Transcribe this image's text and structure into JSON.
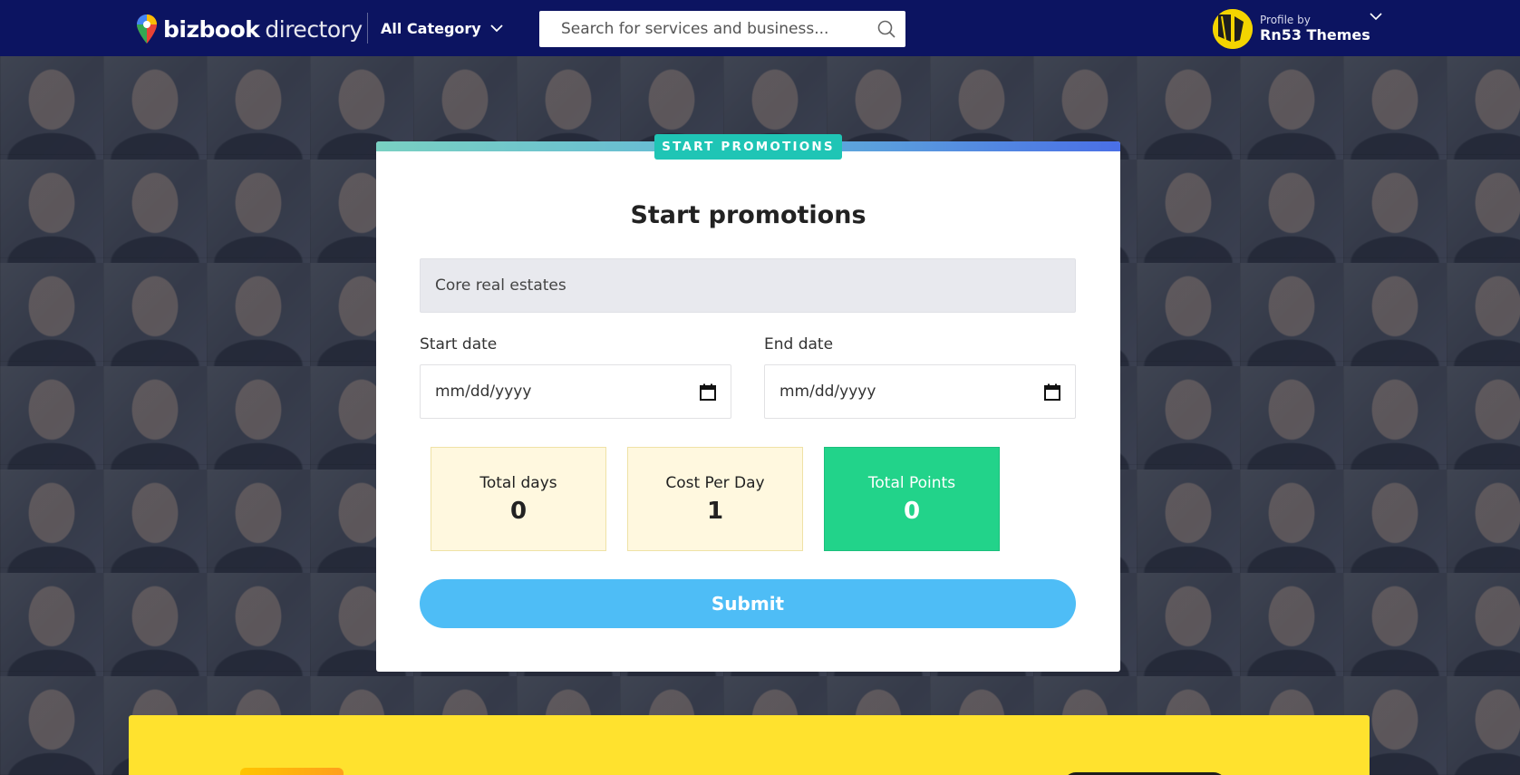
{
  "header": {
    "logo_bold": "bizbook",
    "logo_light": "directory",
    "category_label": "All Category",
    "search_placeholder": "Search for services and business...",
    "profile_small": "Profile by",
    "profile_name": "Rn53 Themes"
  },
  "card": {
    "badge": "START PROMOTIONS",
    "title": "Start promotions",
    "listing_value": "Core real estates",
    "start_label": "Start date",
    "end_label": "End date",
    "date_placeholder": "mm/dd/yyyy",
    "stats": [
      {
        "label": "Total days",
        "value": "0"
      },
      {
        "label": "Cost Per Day",
        "value": "1"
      },
      {
        "label": "Total Points",
        "value": "0"
      }
    ],
    "submit_label": "Submit"
  },
  "colors": {
    "header_bg": "#0c1461",
    "badge": "#1fc5b5",
    "submit": "#4ebdf6",
    "total_points": "#22d38a",
    "stat_bg": "#fff8df",
    "banner": "#ffe22e"
  }
}
